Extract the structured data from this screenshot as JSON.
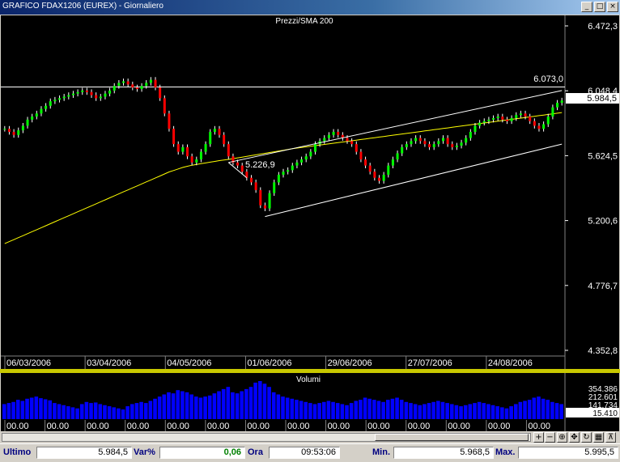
{
  "window": {
    "title": "GRAFICO FDAX1206 (EUREX) - Giornaliero"
  },
  "price_panel": {
    "title": "Prezzi/SMA 200",
    "last_price_label": "5.984,5",
    "resistance_label": "6.073,0",
    "low_label": "5.226,9"
  },
  "volume_panel": {
    "title": "Volumi",
    "y_labels": [
      "354.386",
      "212.601",
      "141.734",
      "15.410"
    ],
    "x_labels": [
      "00.00",
      "00.00",
      "00.00",
      "00.00",
      "00.00",
      "00.00",
      "00.00",
      "00.00",
      "00.00",
      "00.00",
      "00.00",
      "00.00",
      "00.00",
      "00.00"
    ]
  },
  "nav": {
    "plus": "+",
    "minus": "−"
  },
  "status": {
    "ultimo_label": "Ultimo",
    "ultimo_value": "5.984,5",
    "var_label": "Var%",
    "var_value": "0,06",
    "ora_label": "Ora",
    "ora_value": "09:53:06",
    "min_label": "Min.",
    "min_value": "5.968,5",
    "max_label": "Max.",
    "max_value": "5.995,5"
  },
  "colors": {
    "background": "#000000",
    "up_candle": "#00ff00",
    "down_candle": "#ff0000",
    "sma": "#ffff00",
    "channel": "#ffffff",
    "volume_bars": "#0000ff",
    "separator": "#c8c800",
    "var_positive": "#008000"
  },
  "chart_data": [
    {
      "type": "candlestick",
      "title": "Prezzi/SMA 200",
      "y_ticks": [
        "6.472,3",
        "6.048,4",
        "5.624,5",
        "5.200,6",
        "4.776,7",
        "4.352,8"
      ],
      "ylim": [
        4352.8,
        6472.3
      ],
      "x_ticks": [
        "06/03/2006",
        "03/04/2006",
        "04/05/2006",
        "01/06/2006",
        "29/06/2006",
        "27/07/2006",
        "24/08/2006"
      ],
      "grid": false,
      "close_series": [
        5800,
        5780,
        5760,
        5790,
        5820,
        5860,
        5880,
        5900,
        5930,
        5950,
        5980,
        5990,
        6000,
        6010,
        6020,
        6030,
        6040,
        6050,
        6040,
        6020,
        6000,
        6010,
        6030,
        6050,
        6080,
        6100,
        6110,
        6090,
        6070,
        6060,
        6080,
        6100,
        6120,
        6070,
        6000,
        5900,
        5800,
        5700,
        5650,
        5680,
        5620,
        5580,
        5600,
        5650,
        5700,
        5780,
        5800,
        5760,
        5700,
        5620,
        5580,
        5560,
        5520,
        5480,
        5450,
        5400,
        5300,
        5280,
        5380,
        5450,
        5500,
        5520,
        5530,
        5560,
        5580,
        5600,
        5620,
        5650,
        5700,
        5720,
        5740,
        5760,
        5780,
        5760,
        5740,
        5720,
        5700,
        5650,
        5600,
        5560,
        5520,
        5480,
        5460,
        5500,
        5560,
        5600,
        5640,
        5680,
        5700,
        5720,
        5740,
        5720,
        5700,
        5680,
        5700,
        5720,
        5740,
        5700,
        5680,
        5690,
        5710,
        5740,
        5780,
        5820,
        5840,
        5850,
        5860,
        5870,
        5880,
        5860,
        5850,
        5870,
        5890,
        5900,
        5880,
        5850,
        5820,
        5800,
        5830,
        5880,
        5940,
        5970,
        5984.5
      ],
      "sma200": [
        5050,
        5063,
        5076,
        5089,
        5102,
        5115,
        5128,
        5141,
        5154,
        5167,
        5180,
        5193,
        5206,
        5219,
        5232,
        5245,
        5258,
        5271,
        5284,
        5297,
        5310,
        5323,
        5336,
        5349,
        5362,
        5375,
        5388,
        5401,
        5414,
        5427,
        5440,
        5453,
        5466,
        5479,
        5492,
        5505,
        5518,
        5528,
        5538,
        5548,
        5555,
        5562,
        5567,
        5572,
        5577,
        5582,
        5587,
        5592,
        5596,
        5600,
        5605,
        5610,
        5615,
        5620,
        5625,
        5630,
        5635,
        5640,
        5645,
        5650,
        5655,
        5660,
        5665,
        5670,
        5674,
        5678,
        5682,
        5686,
        5690,
        5694,
        5698,
        5702,
        5706,
        5710,
        5714,
        5718,
        5722,
        5726,
        5730,
        5734,
        5738,
        5742,
        5746,
        5750,
        5754,
        5758,
        5762,
        5766,
        5770,
        5774,
        5778,
        5782,
        5786,
        5790,
        5794,
        5798,
        5802,
        5806,
        5810,
        5814,
        5818,
        5822,
        5826,
        5830,
        5834,
        5838,
        5842,
        5846,
        5850,
        5854,
        5858,
        5862,
        5866,
        5870,
        5874,
        5878,
        5882,
        5886,
        5890,
        5894,
        5898,
        5902,
        5906
      ],
      "horizontal_line": 6073.0,
      "annotated_low": 5226.9,
      "last": 5984.5
    },
    {
      "type": "bar",
      "title": "Volumi",
      "y_ticks": [
        "354.386",
        "212.601",
        "141.734",
        "15.410"
      ],
      "values": [
        140000,
        150000,
        160000,
        180000,
        170000,
        190000,
        200000,
        210000,
        195000,
        185000,
        175000,
        150000,
        140000,
        130000,
        120000,
        110000,
        100000,
        140000,
        160000,
        150000,
        155000,
        140000,
        130000,
        120000,
        110000,
        100000,
        90000,
        120000,
        140000,
        150000,
        160000,
        150000,
        170000,
        190000,
        210000,
        230000,
        250000,
        240000,
        270000,
        260000,
        250000,
        230000,
        210000,
        200000,
        210000,
        220000,
        240000,
        260000,
        280000,
        300000,
        250000,
        240000,
        260000,
        280000,
        300000,
        340000,
        354386,
        330000,
        300000,
        250000,
        230000,
        210000,
        200000,
        190000,
        180000,
        170000,
        160000,
        150000,
        140000,
        150000,
        160000,
        170000,
        160000,
        150000,
        140000,
        130000,
        150000,
        170000,
        180000,
        200000,
        190000,
        180000,
        170000,
        160000,
        180000,
        190000,
        200000,
        180000,
        160000,
        150000,
        140000,
        130000,
        140000,
        150000,
        160000,
        170000,
        160000,
        150000,
        140000,
        130000,
        120000,
        130000,
        140000,
        150000,
        160000,
        150000,
        140000,
        130000,
        120000,
        110000,
        100000,
        120000,
        140000,
        160000,
        170000,
        180000,
        200000,
        210000,
        190000,
        180000,
        160000,
        150000,
        140000
      ]
    }
  ]
}
